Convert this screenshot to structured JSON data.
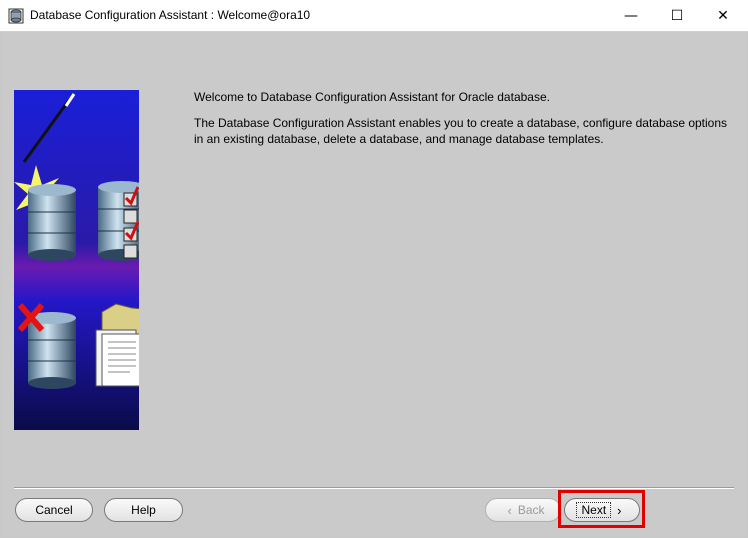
{
  "window": {
    "title": "Database Configuration Assistant : Welcome@ora10",
    "controls": {
      "minimize": "—",
      "maximize": "☐",
      "close": "✕"
    }
  },
  "content": {
    "welcome": "Welcome to Database Configuration Assistant for Oracle database.",
    "description": "The Database Configuration Assistant enables you to create a database, configure database options in an existing database, delete a database, and manage database templates."
  },
  "buttons": {
    "cancel": "Cancel",
    "help": "Help",
    "back": "Back",
    "next": "Next",
    "back_icon": "‹",
    "next_icon": "›"
  },
  "colors": {
    "panel_background": "#cacaca",
    "highlight": "#e00000"
  }
}
